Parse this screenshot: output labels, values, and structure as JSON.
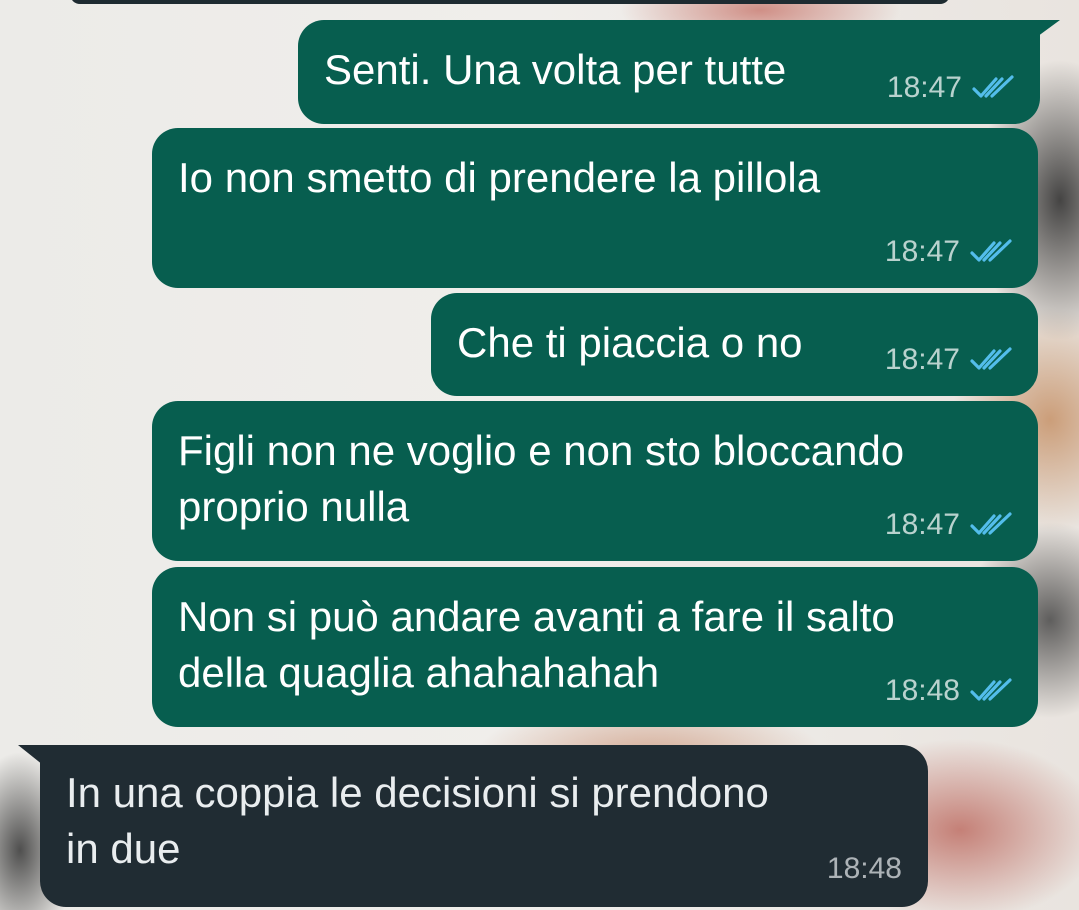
{
  "chat": {
    "messages": [
      {
        "direction": "out",
        "text": "Senti. Una volta per tutte",
        "time": "18:47",
        "status_icon": "double-check-read-icon"
      },
      {
        "direction": "out",
        "text": "Io non smetto di prendere la pillola",
        "time": "18:47",
        "status_icon": "double-check-read-icon"
      },
      {
        "direction": "out",
        "text": "Che ti piaccia o no",
        "time": "18:47",
        "status_icon": "double-check-read-icon"
      },
      {
        "direction": "out",
        "text": "Figli non ne voglio e non sto bloccando\nproprio nulla",
        "time": "18:47",
        "status_icon": "double-check-read-icon"
      },
      {
        "direction": "out",
        "text": "Non si può andare avanti a fare il salto\ndella quaglia ahahahahah",
        "time": "18:48",
        "status_icon": "double-check-read-icon"
      },
      {
        "direction": "in",
        "text": "In una coppia le decisioni si prendono\nin due",
        "time": "18:48"
      }
    ]
  },
  "colors": {
    "outgoing_bubble": "#075e4f",
    "incoming_bubble": "#202c33",
    "read_check": "#53bdeb"
  }
}
